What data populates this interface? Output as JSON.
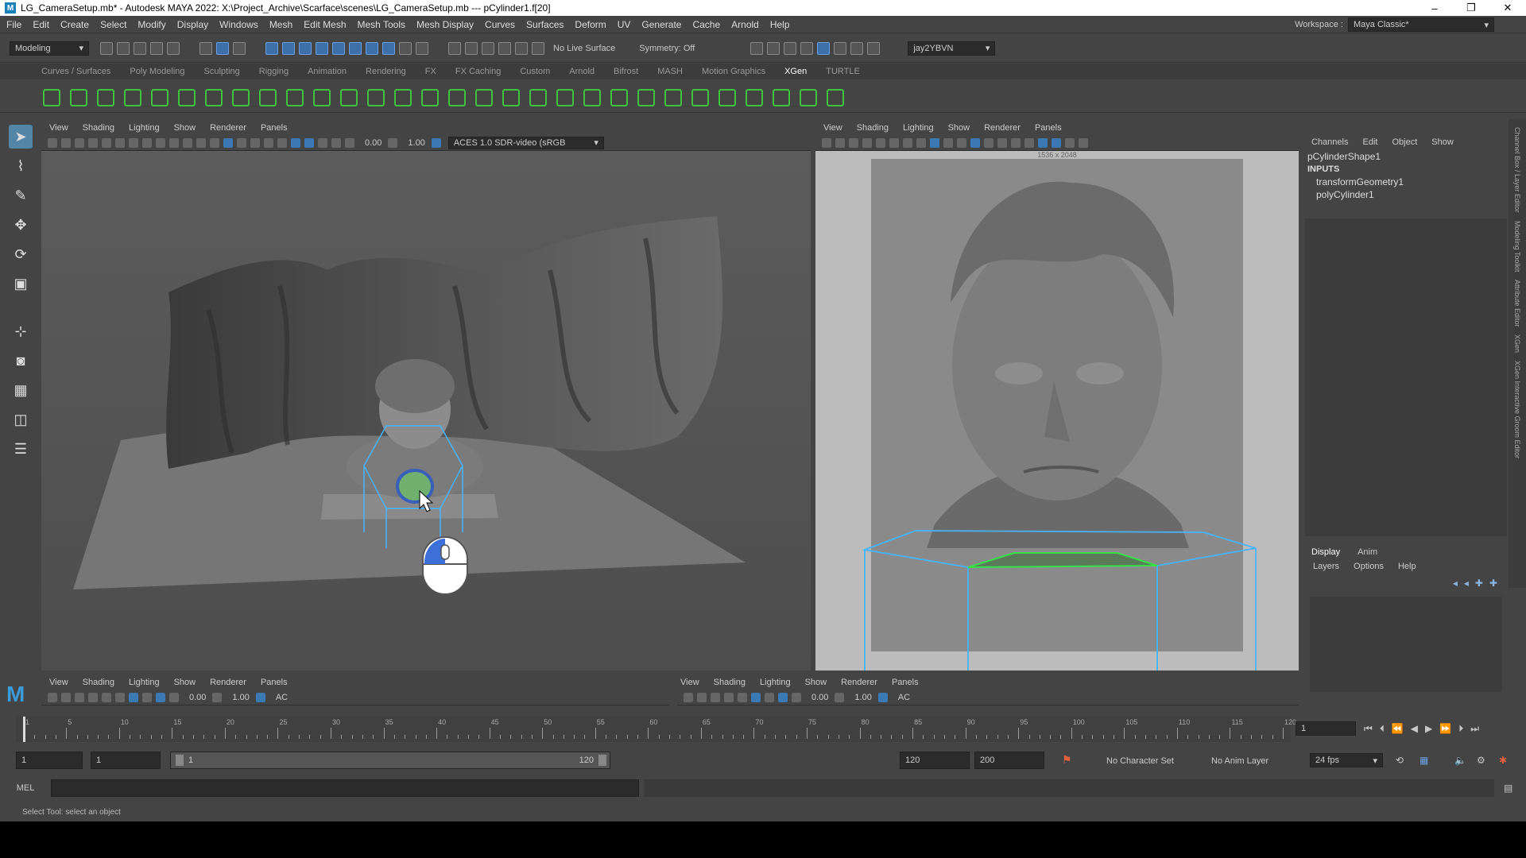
{
  "window": {
    "title": "LG_CameraSetup.mb* - Autodesk MAYA 2022: X:\\Project_Archive\\Scarface\\scenes\\LG_CameraSetup.mb  ---  pCylinder1.f[20]",
    "minimize": "–",
    "restore": "❐",
    "close": "✕"
  },
  "menu": [
    "File",
    "Edit",
    "Create",
    "Select",
    "Modify",
    "Display",
    "Windows",
    "Mesh",
    "Edit Mesh",
    "Mesh Tools",
    "Mesh Display",
    "Curves",
    "Surfaces",
    "Deform",
    "UV",
    "Generate",
    "Cache",
    "Arnold",
    "Help"
  ],
  "workspace": {
    "label": "Workspace :",
    "value": "Maya Classic*"
  },
  "status": {
    "mode": "Modeling",
    "live_surface": "No Live Surface",
    "symmetry": "Symmetry: Off",
    "user": "jay2YBVN"
  },
  "shelf_tabs": [
    "Curves / Surfaces",
    "Poly Modeling",
    "Sculpting",
    "Rigging",
    "Animation",
    "Rendering",
    "FX",
    "FX Caching",
    "Custom",
    "Arnold",
    "Bifrost",
    "MASH",
    "Motion Graphics",
    "XGen",
    "TURTLE"
  ],
  "shelf_active": "XGen",
  "panel_menu": [
    "View",
    "Shading",
    "Lighting",
    "Show",
    "Renderer",
    "Panels"
  ],
  "panel_values": {
    "exposure": "0.00",
    "gamma": "1.00",
    "colorspace": "ACES 1.0 SDR-video (sRGB",
    "ac": "AC"
  },
  "resolution_gate": "1536 x 2048",
  "channel_box": {
    "menu": [
      "Channels",
      "Edit",
      "Object",
      "Show"
    ],
    "shape": "pCylinderShape1",
    "inputs_label": "INPUTS",
    "inputs": [
      "transformGeometry1",
      "polyCylinder1"
    ]
  },
  "layer_editor": {
    "tabs": [
      "Display",
      "Anim"
    ],
    "menu": [
      "Layers",
      "Options",
      "Help"
    ]
  },
  "side_tabs": [
    "Channel Box / Layer Editor",
    "Modeling Toolkit",
    "Attribute Editor",
    "XGen",
    "XGen Interactive Groom Editor"
  ],
  "timeline": {
    "ticks": [
      "1",
      "5",
      "10",
      "15",
      "20",
      "25",
      "30",
      "35",
      "40",
      "45",
      "50",
      "55",
      "60",
      "65",
      "70",
      "75",
      "80",
      "85",
      "90",
      "95",
      "100",
      "105",
      "110",
      "115",
      "120"
    ],
    "current": "1"
  },
  "range": {
    "start": "1",
    "playback_start": "1",
    "slider_start": "1",
    "slider_end": "120",
    "playback_end": "120",
    "end": "200",
    "character_set": "No Character Set",
    "anim_layer": "No Anim Layer",
    "fps": "24 fps"
  },
  "cmd": {
    "lang": "MEL"
  },
  "help_line": "Select Tool: select an object"
}
